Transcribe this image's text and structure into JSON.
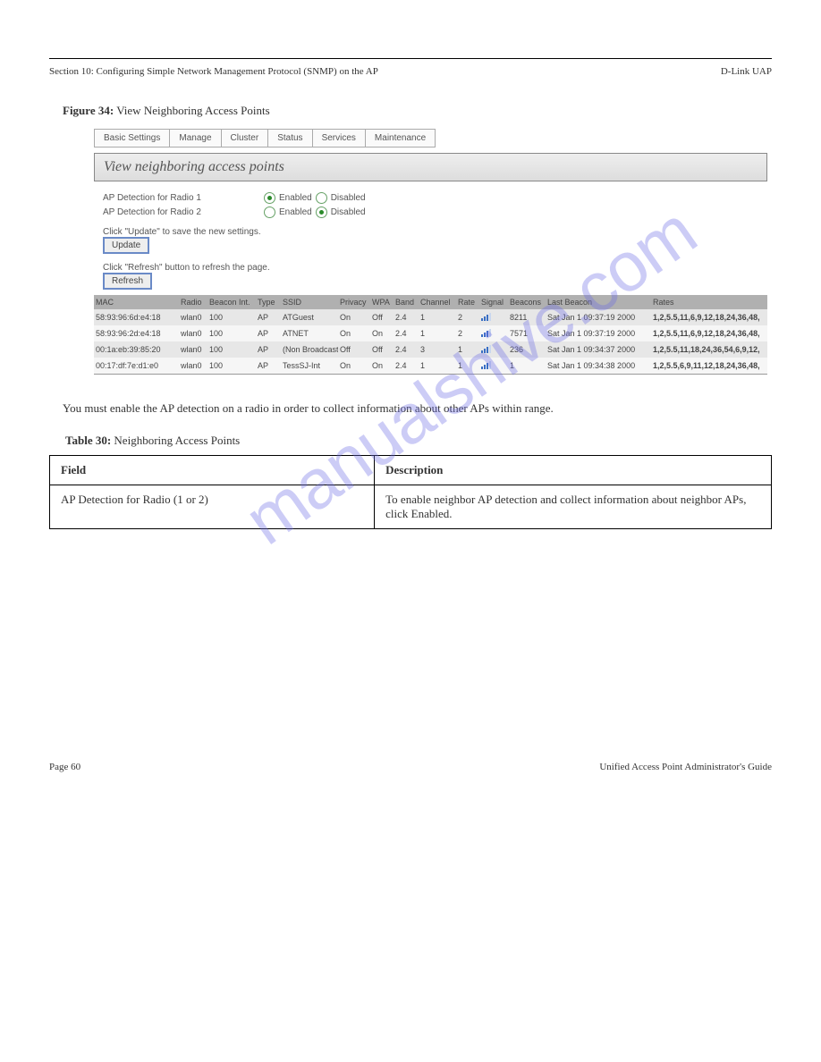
{
  "header": {
    "section": "Section 10: Configuring Simple Network Management Protocol (SNMP) on the AP",
    "doc": "D-Link UAP"
  },
  "figure": {
    "num": "Figure 34:",
    "caption": "View Neighboring Access Points"
  },
  "tabs": [
    "Basic Settings",
    "Manage",
    "Cluster",
    "Status",
    "Services",
    "Maintenance"
  ],
  "page_title": "View neighboring access points",
  "radio1": {
    "label": "AP Detection for Radio 1",
    "enabled": "Enabled",
    "disabled": "Disabled",
    "state": "enabled"
  },
  "radio2": {
    "label": "AP Detection for Radio 2",
    "enabled": "Enabled",
    "disabled": "Disabled",
    "state": "disabled"
  },
  "instr_update": "Click \"Update\" to save the new settings.",
  "btn_update": "Update",
  "instr_refresh": "Click \"Refresh\" button to refresh the page.",
  "btn_refresh": "Refresh",
  "ap_headers": [
    "MAC",
    "Radio",
    "Beacon Int.",
    "Type",
    "SSID",
    "Privacy",
    "WPA",
    "Band",
    "Channel",
    "Rate",
    "Signal",
    "Beacons",
    "Last Beacon",
    "Rates"
  ],
  "ap_rows": [
    {
      "mac": "58:93:96:6d:e4:18",
      "radio": "wlan0",
      "bint": "100",
      "type": "AP",
      "ssid": "ATGuest",
      "privacy": "On",
      "wpa": "Off",
      "band": "2.4",
      "channel": "1",
      "rate": "2",
      "beacons": "8211",
      "last": "Sat Jan 1 09:37:19 2000",
      "rates": "1,2,5.5,11,6,9,12,18,24,36,48,"
    },
    {
      "mac": "58:93:96:2d:e4:18",
      "radio": "wlan0",
      "bint": "100",
      "type": "AP",
      "ssid": "ATNET",
      "privacy": "On",
      "wpa": "On",
      "band": "2.4",
      "channel": "1",
      "rate": "2",
      "beacons": "7571",
      "last": "Sat Jan 1 09:37:19 2000",
      "rates": "1,2,5.5,11,6,9,12,18,24,36,48,"
    },
    {
      "mac": "00:1a:eb:39:85:20",
      "radio": "wlan0",
      "bint": "100",
      "type": "AP",
      "ssid": "(Non Broadcasting)",
      "privacy": "Off",
      "wpa": "Off",
      "band": "2.4",
      "channel": "3",
      "rate": "1",
      "beacons": "236",
      "last": "Sat Jan 1 09:34:37 2000",
      "rates": "1,2,5.5,11,18,24,36,54,6,9,12,"
    },
    {
      "mac": "00:17:df:7e:d1:e0",
      "radio": "wlan0",
      "bint": "100",
      "type": "AP",
      "ssid": "TessSJ-Int",
      "privacy": "On",
      "wpa": "On",
      "band": "2.4",
      "channel": "1",
      "rate": "1",
      "beacons": "1",
      "last": "Sat Jan 1 09:34:38 2000",
      "rates": "1,2,5.5,6,9,11,12,18,24,36,48,"
    }
  ],
  "bodytext": "You must enable the AP detection on a radio in order to collect information about other APs within range.",
  "table_caption": {
    "num": "Table 30:",
    "text": "Neighboring Access Points"
  },
  "desc_header": {
    "field": "Field",
    "desc": "Description"
  },
  "desc_row": {
    "field": "AP Detection for Radio (1 or 2)",
    "desc": "To enable neighbor AP detection and collect information about neighbor APs, click Enabled."
  },
  "footer": {
    "left": "Page 60",
    "right": "Unified Access Point Administrator's Guide"
  },
  "watermark": "manualshive.com"
}
